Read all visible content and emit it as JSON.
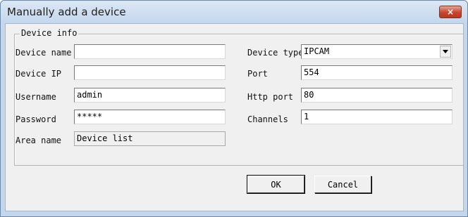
{
  "window": {
    "title": "Manually add a device",
    "close_glyph": "×"
  },
  "group": {
    "legend": "Device info"
  },
  "fields": {
    "device_name": {
      "label": "Device name",
      "value": ""
    },
    "device_ip": {
      "label": "Device IP",
      "value": ""
    },
    "username": {
      "label": "Username",
      "value": "admin"
    },
    "password": {
      "label": "Password",
      "value": "*****"
    },
    "area_name": {
      "label": "Area name",
      "value": "Device list"
    },
    "device_type": {
      "label": "Device type",
      "value": "IPCAM"
    },
    "port": {
      "label": "Port",
      "value": "554"
    },
    "http_port": {
      "label": "Http port",
      "value": "80"
    },
    "channels": {
      "label": "Channels",
      "value": "1"
    }
  },
  "buttons": {
    "ok": "OK",
    "cancel": "Cancel"
  },
  "icons": {
    "close": "close-icon",
    "dropdown": "chevron-down-icon"
  },
  "colors": {
    "titlebar": "#c4d7ed",
    "close_button": "#c7452c",
    "client_background": "#f0f0f0"
  }
}
